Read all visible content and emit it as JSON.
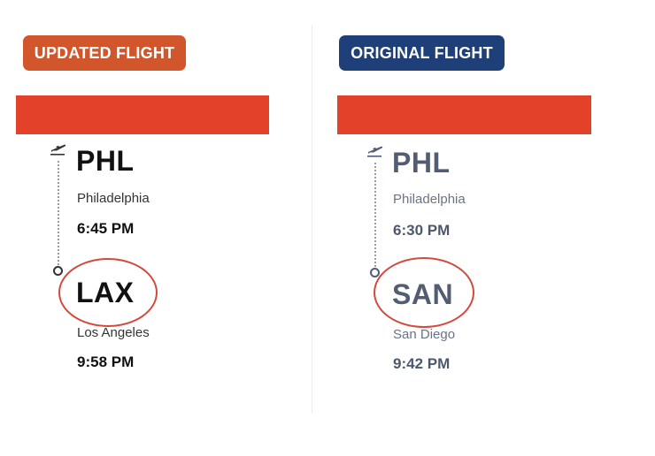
{
  "updated_flight": {
    "badge_label": "UPDATED FLIGHT",
    "badge_color": "#d2562c",
    "origin": {
      "code": "PHL",
      "city": "Philadelphia",
      "time": "6:45 PM"
    },
    "destination": {
      "code": "LAX",
      "city": "Los Angeles",
      "time": "9:58 PM"
    }
  },
  "original_flight": {
    "badge_label": "ORIGINAL FLIGHT",
    "badge_color": "#1f3f78",
    "origin": {
      "code": "PHL",
      "city": "Philadelphia",
      "time": "6:30 PM"
    },
    "destination": {
      "code": "SAN",
      "city": "San Diego",
      "time": "9:42 PM"
    }
  },
  "colors": {
    "stripe": "#e4412b",
    "highlight_circle": "#d24a3c"
  },
  "icons": {
    "departure": "plane-takeoff-icon",
    "arrival": "destination-dot-icon"
  }
}
